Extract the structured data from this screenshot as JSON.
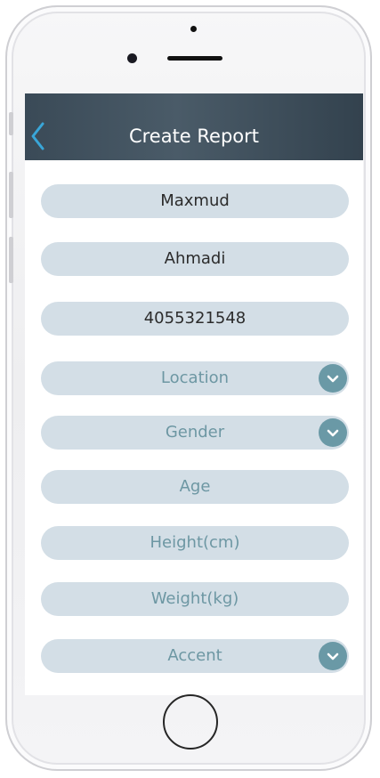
{
  "header": {
    "title": "Create Report",
    "back_icon": "chevron-left-icon",
    "colors": {
      "bar_left": "#3a4a57",
      "bar_right": "#33424e",
      "back_icon": "#39a6d8",
      "title": "#ffffff"
    }
  },
  "form": {
    "first_name": {
      "value": "Maxmud"
    },
    "last_name": {
      "value": "Ahmadi"
    },
    "phone": {
      "value": "4055321548"
    },
    "location": {
      "placeholder": "Location",
      "icon": "chevron-down-icon"
    },
    "gender": {
      "placeholder": "Gender",
      "icon": "chevron-down-icon"
    },
    "age": {
      "placeholder": "Age"
    },
    "height": {
      "placeholder": "Height(cm)"
    },
    "weight": {
      "placeholder": "Weight(kg)"
    },
    "accent": {
      "placeholder": "Accent",
      "icon": "chevron-down-icon"
    },
    "colors": {
      "field_bg": "#d3dee6",
      "value_text": "#2b2b2b",
      "placeholder_text": "#6d97a3",
      "dropdown_icon_bg": "#6a99a6"
    }
  }
}
